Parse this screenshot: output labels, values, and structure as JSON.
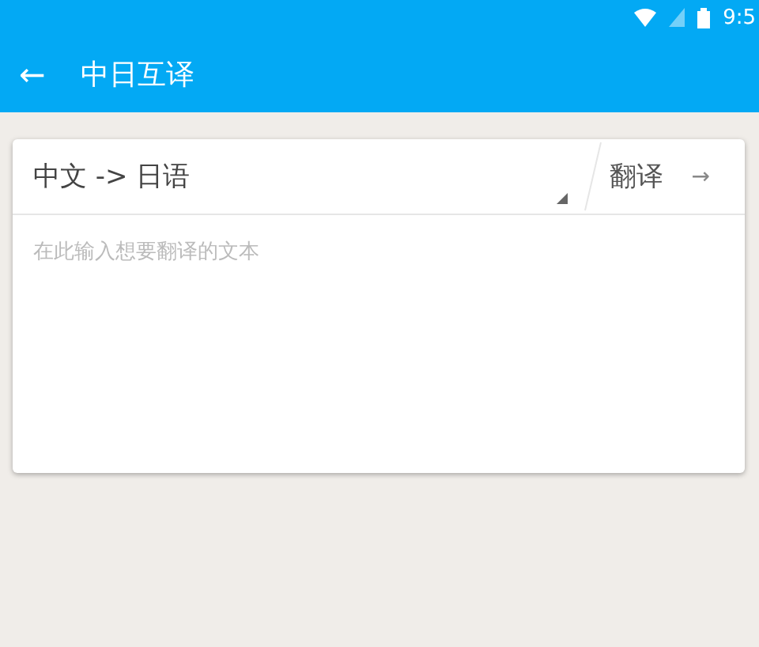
{
  "status_bar": {
    "time": "9:5"
  },
  "app_bar": {
    "back_icon": "←",
    "title": "中日互译"
  },
  "translator": {
    "language_pair": "中文 -> 日语",
    "translate_button": "翻译",
    "arrow": "→",
    "input": {
      "placeholder": "在此输入想要翻译的文本"
    }
  }
}
